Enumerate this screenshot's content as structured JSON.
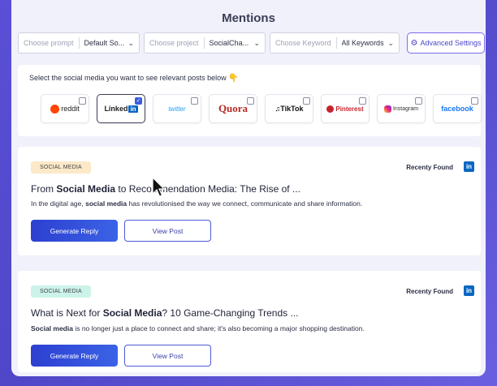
{
  "header": {
    "title": "Mentions"
  },
  "filters": {
    "prompt": {
      "placeholder": "Choose prompt",
      "value": "Default So..."
    },
    "project": {
      "placeholder": "Choose project",
      "value": "SocialCha..."
    },
    "keyword": {
      "placeholder": "Choose Keyword",
      "value": "All Keywords"
    },
    "advanced_label": "Advanced Settings"
  },
  "social": {
    "prompt": "Select the social media you want to see relevant posts below",
    "platforms": [
      {
        "name": "reddit",
        "selected": false
      },
      {
        "name": "Linked",
        "badge": "in",
        "selected": true
      },
      {
        "name": "twitter",
        "selected": false
      },
      {
        "name": "Quora",
        "selected": false
      },
      {
        "name": "TikTok",
        "selected": false
      },
      {
        "name": "Pinterest",
        "selected": false
      },
      {
        "name": "Instagram",
        "selected": false
      },
      {
        "name": "facebook",
        "selected": false
      }
    ]
  },
  "posts": [
    {
      "tag": "SOCIAL MEDIA",
      "tag_color": "#fbe9c9",
      "found_label": "Recenty Found",
      "platform_badge": "in",
      "title_pre": "From ",
      "title_bold": "Social Media",
      "title_post": " to Recommendation Media: The Rise of ...",
      "desc_pre": "In the digital age, ",
      "desc_bold": "social media",
      "desc_post": " has revolutionised the way we connect, communicate and share information.",
      "generate_label": "Generate Reply",
      "view_label": "View Post"
    },
    {
      "tag": "SOCIAL MEDIA",
      "tag_color": "#ccf3ea",
      "found_label": "Recenty Found",
      "platform_badge": "in",
      "title_pre": "What is Next for ",
      "title_bold": "Social Media",
      "title_post": "? 10 Game-Changing Trends ...",
      "desc_pre": "",
      "desc_bold": "Social media",
      "desc_post": " is no longer just a place to connect and share; it's also becoming a major shopping destination.",
      "generate_label": "Generate Reply",
      "view_label": "View Post"
    }
  ]
}
